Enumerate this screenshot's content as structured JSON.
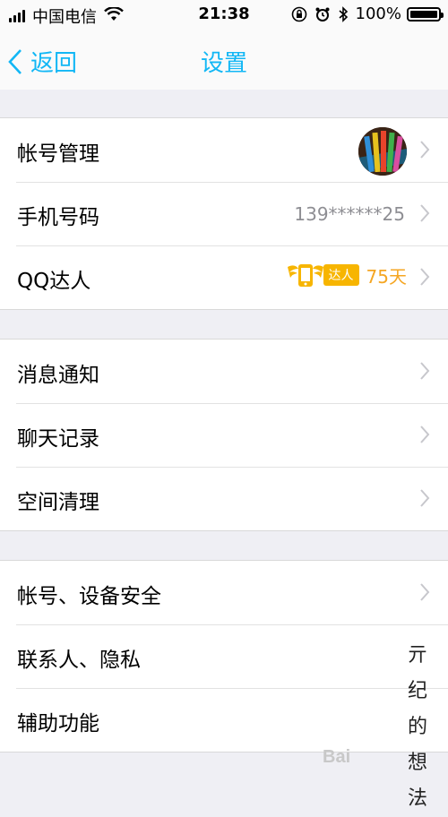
{
  "status_bar": {
    "carrier": "中国电信",
    "time": "21:38",
    "battery": "100%",
    "icons": [
      "signal-icon",
      "wifi-icon",
      "orientation-lock-icon",
      "alarm-icon",
      "bluetooth-icon",
      "battery-icon"
    ]
  },
  "nav": {
    "back_label": "返回",
    "title": "设置"
  },
  "group1": {
    "account": {
      "label": "帐号管理"
    },
    "phone": {
      "label": "手机号码",
      "value": "139******25"
    },
    "qq_talent": {
      "label": "QQ达人",
      "badge": "达人",
      "days": "75天"
    }
  },
  "group2": {
    "notifications": {
      "label": "消息通知"
    },
    "chat_history": {
      "label": "聊天记录"
    },
    "storage": {
      "label": "空间清理"
    }
  },
  "group3": {
    "security": {
      "label": "帐号、设备安全"
    },
    "privacy": {
      "label": "联系人、隐私"
    },
    "accessibility": {
      "label": "辅助功能"
    }
  },
  "watermark": {
    "chars": [
      "亓",
      "纪",
      "的",
      "想",
      "法"
    ],
    "logo": "Bai"
  },
  "colors": {
    "accent": "#12b7f5",
    "talent_orange": "#f7b500",
    "background": "#efeff4",
    "chevron": "#c7c7cc"
  }
}
